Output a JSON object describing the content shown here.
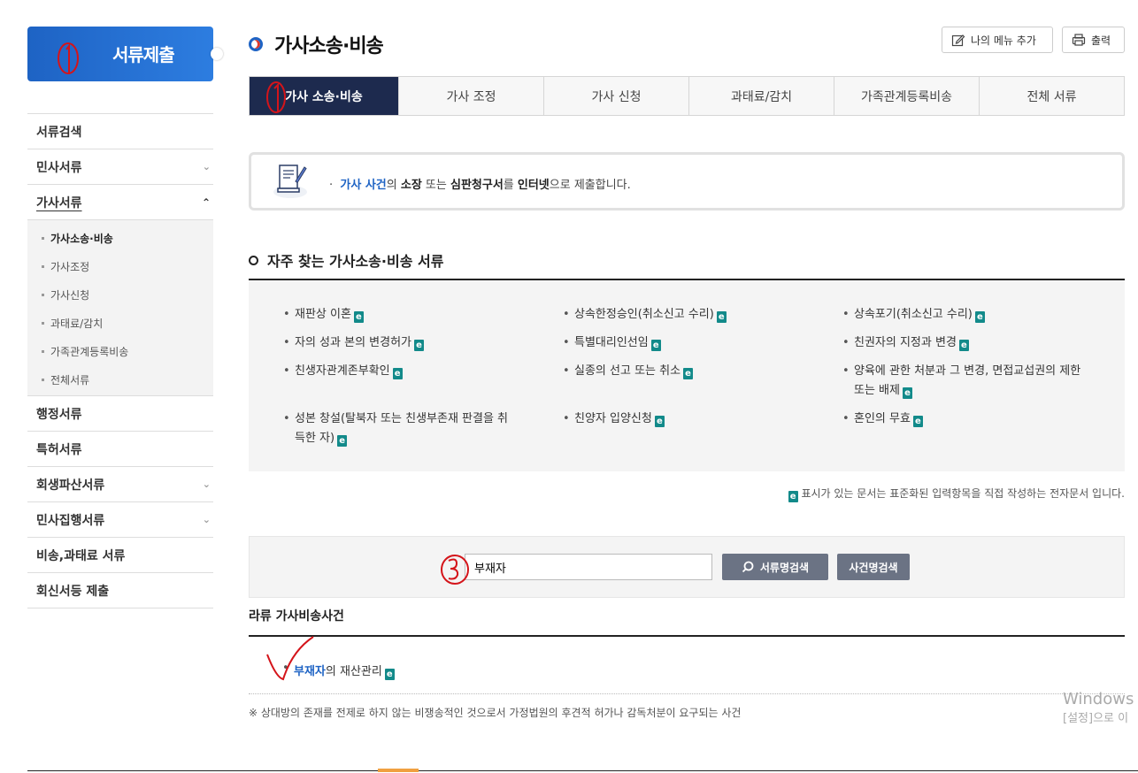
{
  "sidebar": {
    "header_title": "서류제출",
    "items": [
      {
        "label": "서류검색",
        "chevron": ""
      },
      {
        "label": "민사서류",
        "chevron": "﹀"
      },
      {
        "label": "가사서류",
        "chevron": "︿"
      },
      {
        "label": "행정서류",
        "chevron": ""
      },
      {
        "label": "특허서류",
        "chevron": ""
      },
      {
        "label": "회생파산서류",
        "chevron": "﹀"
      },
      {
        "label": "민사집행서류",
        "chevron": "﹀"
      },
      {
        "label": "비송,과태료 서류",
        "chevron": ""
      },
      {
        "label": "회신서등 제출",
        "chevron": ""
      }
    ],
    "sub_items": [
      "가사소송·비송",
      "가사조정",
      "가사신청",
      "과태료/감치",
      "가족관계등록비송",
      "전체서류"
    ]
  },
  "header": {
    "title": "가사소송·비송",
    "my_menu_label": "나의 메뉴 추가",
    "print_label": "출력"
  },
  "tabs": [
    "가사 소송·비송",
    "가사 조정",
    "가사 신청",
    "과태료/감치",
    "가족관계등록비송",
    "전체 서류"
  ],
  "info": {
    "bullet": "·",
    "p1": "가사 사건",
    "p2": "의 ",
    "p3": "소장",
    "p4": " 또는 ",
    "p5": "심판청구서",
    "p6": "를 ",
    "p7": "인터넷",
    "p8": "으로 제출합니다."
  },
  "section": {
    "title": "자주 찾는 가사소송·비송 서류",
    "docs": [
      "재판상 이혼",
      "상속한정승인(취소신고 수리)",
      "상속포기(취소신고 수리)",
      "자의 성과 본의 변경허가",
      "특별대리인선임",
      "친권자의 지정과 변경",
      "친생자관계존부확인",
      "실종의 선고 또는 취소",
      "양육에 관한 처분과 그 변경, 면접교섭권의 제한 또는 배제",
      "성본 창설(탈북자 또는 친생부존재 판결을 취득한 자)",
      "친양자 입양신청",
      "혼인의 무효"
    ],
    "e_icon": "e",
    "note": "표시가 있는 문서는 표준화된 입력항목을 직접 작성하는 전자문서 입니다."
  },
  "search": {
    "value": "부재자",
    "doc_search_label": "서류명검색",
    "case_search_label": "사건명검색"
  },
  "results": {
    "heading": "라류 가사비송사건",
    "item_hl": "부재자",
    "item_rest": "의 재산관리",
    "footnote": "※ 상대방의 존재를 전제로 하지 않는 비쟁송적인 것으로서 가정법원의 후견적 허가나 감독처분이 요구되는 사건"
  },
  "watermark": {
    "line1": "Windows",
    "line2": "[설정]으로 이"
  }
}
